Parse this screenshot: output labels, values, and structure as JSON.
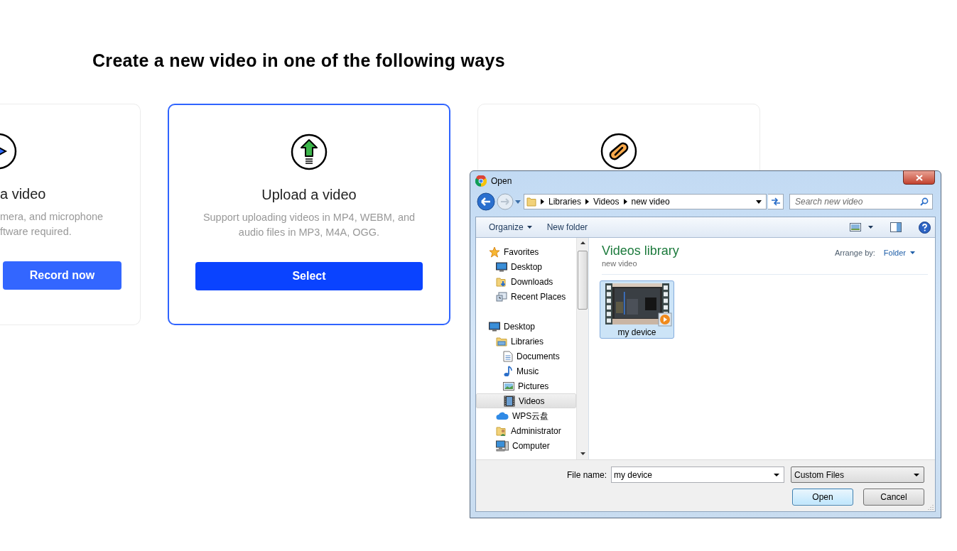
{
  "heading": "Create a new video in one of the following ways",
  "cards": [
    {
      "kind": "record",
      "selected": false,
      "title": "a video",
      "description_lines": [
        "mera, and microphone",
        "ftware required."
      ],
      "button": "Record now"
    },
    {
      "kind": "upload",
      "selected": true,
      "title": "Upload a video",
      "description_lines": [
        "Support uploading videos in MP4, WEBM, and",
        "audio files in MP3, M4A, OGG."
      ],
      "button": "Select"
    },
    {
      "kind": "link",
      "selected": false
    }
  ],
  "dialog": {
    "title": "Open",
    "breadcrumb": [
      "Libraries",
      "Videos",
      "new video"
    ],
    "search": {
      "placeholder": "Search new video"
    },
    "toolbar": [
      {
        "label": "Organize",
        "kind": "menu"
      },
      {
        "label": "New folder",
        "kind": "button"
      }
    ],
    "nav": [
      {
        "label": "Favorites",
        "kind": "star",
        "selected": false,
        "children": [
          {
            "label": "Desktop",
            "kind": "desktop",
            "selected": false
          },
          {
            "label": "Downloads",
            "kind": "downloads",
            "selected": false
          },
          {
            "label": "Recent Places",
            "kind": "recent",
            "selected": false
          }
        ]
      },
      {
        "label": "Desktop",
        "kind": "desktop",
        "selected": false,
        "children": [
          {
            "label": "Libraries",
            "kind": "libraries",
            "selected": false,
            "children": [
              {
                "label": "Documents",
                "kind": "document",
                "selected": false
              },
              {
                "label": "Music",
                "kind": "music",
                "selected": false
              },
              {
                "label": "Pictures",
                "kind": "pictures",
                "selected": false
              },
              {
                "label": "Videos",
                "kind": "videos",
                "selected": true
              }
            ]
          },
          {
            "label": "WPS云盘",
            "kind": "cloud",
            "selected": false
          },
          {
            "label": "Administrator",
            "kind": "user",
            "selected": false
          },
          {
            "label": "Computer",
            "kind": "computer",
            "selected": false
          }
        ]
      }
    ],
    "library": {
      "title": "Videos library",
      "subtitle": "new video",
      "arrange_label": "Arrange by:",
      "arrange_value": "Folder"
    },
    "files": [
      {
        "name": "my device",
        "kind": "video",
        "selected": true
      }
    ],
    "file_name": {
      "label": "File name:",
      "value": "my device"
    },
    "file_type": "Custom Files",
    "buttons": [
      {
        "label": "Open",
        "kind": "default"
      },
      {
        "label": "Cancel",
        "kind": "normal"
      }
    ]
  }
}
